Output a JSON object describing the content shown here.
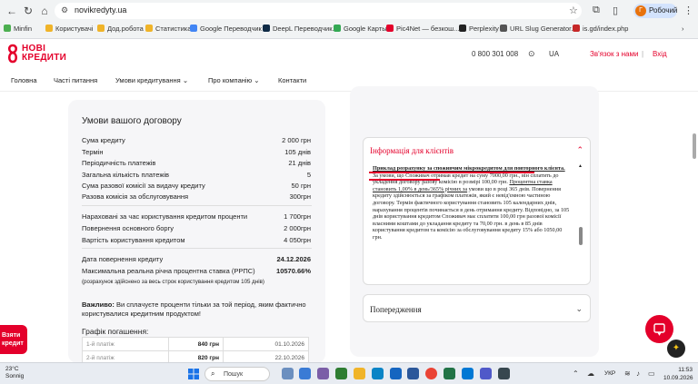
{
  "browser": {
    "url": "novikredyty.ua",
    "profile_label": "Робочий",
    "profile_initial": "Г",
    "bookmarks": [
      "Minfin",
      "Користувачі",
      "Дод.робота",
      "Статистика",
      "Google Переводчик",
      "DeepL Переводчик...",
      "Google Карты",
      "Pic4Net — безкош...",
      "Perplexity",
      "URL Slug Generator...",
      "is.gd/index.php"
    ]
  },
  "header": {
    "logo_line1": "НОВІ",
    "logo_line2": "КРЕДИТИ",
    "phone": "0 800 301 008",
    "lang": "UA",
    "contact_link": "Зв'язок з нами",
    "login_link": "Вхід"
  },
  "nav": {
    "items": [
      "Головна",
      "Часті питання",
      "Умови кредитування",
      "Про компанію",
      "Контакти"
    ]
  },
  "contract": {
    "title": "Умови вашого договору",
    "rows_group1": [
      {
        "label": "Сума кредиту",
        "value": "2 000 грн"
      },
      {
        "label": "Термін",
        "value": "105 днів"
      },
      {
        "label": "Періодичність платежів",
        "value": "21 днів"
      },
      {
        "label": "Загальна кількість платежів",
        "value": "5"
      },
      {
        "label": "Сума разової комісії за видачу кредиту",
        "value": "50 грн"
      },
      {
        "label": "Разова комісія за обслуговування",
        "value": "300грн"
      }
    ],
    "rows_group2": [
      {
        "label": "Нараховані за час користування кредитом проценти",
        "value": "1 700грн"
      },
      {
        "label": "Повернення основного боргу",
        "value": "2 000грн"
      },
      {
        "label": "Вартість користування кредитом",
        "value": "4 050грн"
      }
    ],
    "rows_group3": [
      {
        "label": "Дата повернення кредиту",
        "value": "24.12.2026"
      },
      {
        "label": "Максимальна реальна річна процентна ставка (РРПС)",
        "value": "10570.66%"
      }
    ],
    "footnote": "(розрахунок здійснено за весь строк користування кредитом 105 днів)",
    "notice_bold": "Важливо:",
    "notice_text": " Ви сплачуєте проценти тільки за той період, яким фактично користувалися кредитним продуктом!",
    "schedule_title": "Графік погашення:",
    "schedule": [
      {
        "n": "1-й платіж",
        "amount": "840 грн",
        "date": "01.10.2026"
      },
      {
        "n": "2-й платіж",
        "amount": "820 грн",
        "date": "22.10.2026"
      }
    ]
  },
  "info_panel": {
    "title": "Інформація для клієнтів",
    "heading": "Приклад розрахунку за споживчим мікрокредитом для повторного клієнта.",
    "para_part1": "За умови, що Споживач отримав кредит на суму 7000,00 грн., він сплатить до укладення договору разову комісію в розмірі 100,00 грн. ",
    "para_rate": "Процентна ставка становить 1,00% в день/365% річних за",
    "para_part2": " умови що в році 365 днів. Повернення кредиту здійснюється за графіком платежів, який є невід'ємною частиною договору. Термін фактичного користування становить 105 календарних днів, нарахування процентів починається в день отримання кредиту. Відповідно, за 105 днів користування кредитом Споживач має сплатити 100,00 грн разової комісії власними коштами до укладання кредиту та 70,00 грн. в день в 85 днів користування кредитом та комісію за обслуговування кредиту 15% або 1050,00 грн."
  },
  "warning_panel": {
    "title": "Попередження"
  },
  "floating": {
    "take_credit": "Взяти кредит"
  },
  "taskbar": {
    "temp": "23°C",
    "weather": "Sonnig",
    "search": "Пошук",
    "lang": "УКР",
    "time": "11:53",
    "date": "10.09.2026"
  },
  "colors": {
    "brand_red": "#e4002b",
    "panel_bg": "#f6f6f8"
  }
}
